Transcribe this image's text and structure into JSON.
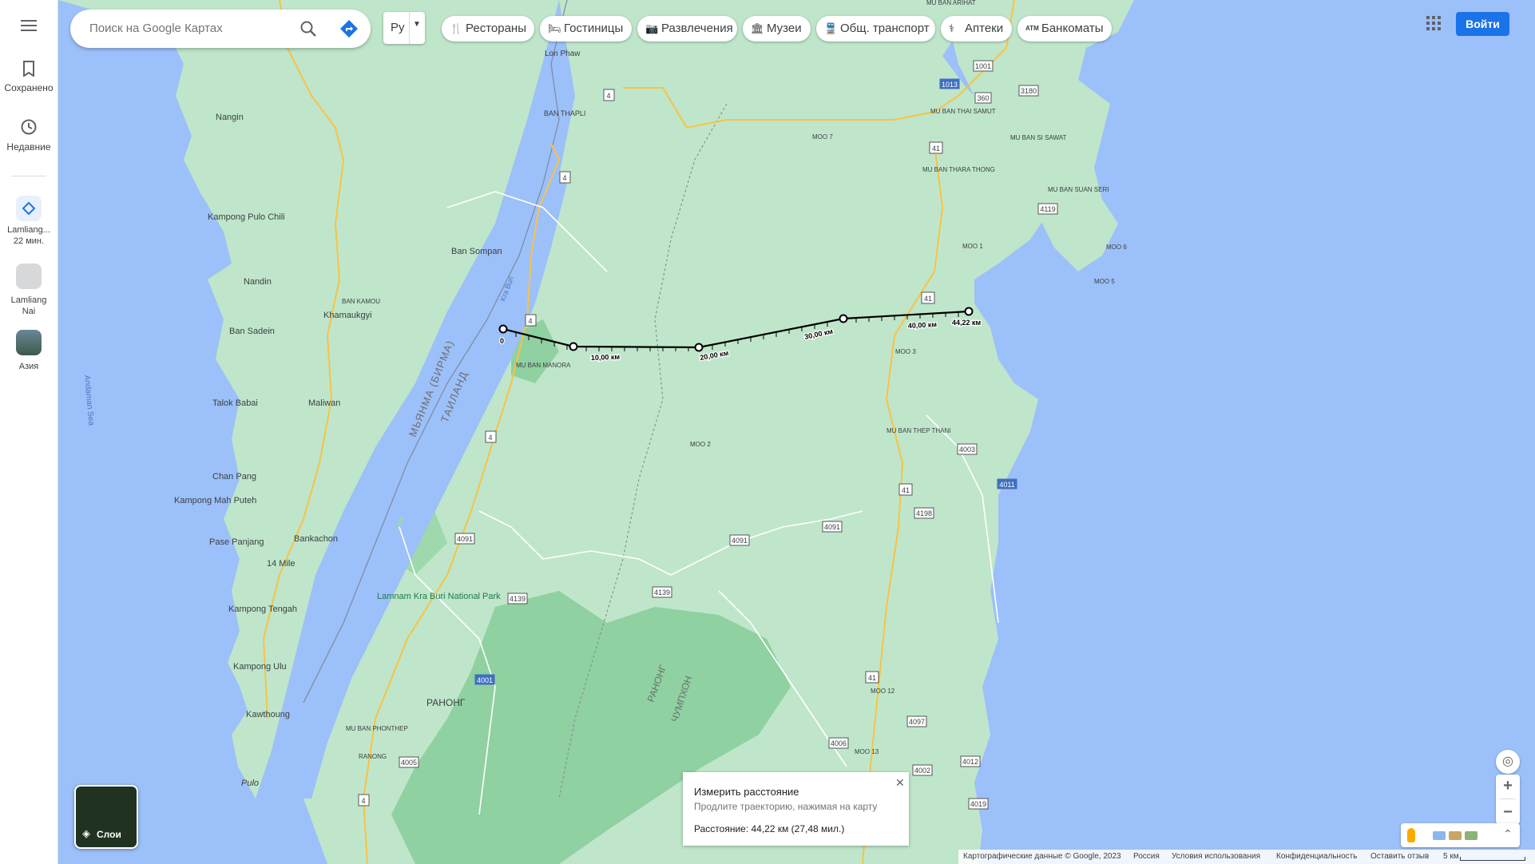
{
  "sidebar": {
    "menu_icon": "menu-icon",
    "items": [
      {
        "label": "Сохранено",
        "icon": "bookmark-icon"
      },
      {
        "label": "Недавние",
        "icon": "history-icon"
      },
      {
        "label": "Lamliang...",
        "sub": "22 мин.",
        "icon": "directions-icon"
      },
      {
        "label": "Lamliang Nai",
        "icon": "place-thumbnail"
      },
      {
        "label": "Азия",
        "icon": "place-thumbnail"
      }
    ]
  },
  "search": {
    "placeholder": "Поиск на Google Картах"
  },
  "language": {
    "code": "Ру"
  },
  "chips": [
    {
      "label": "Рестораны",
      "icon": "restaurant-icon"
    },
    {
      "label": "Гостиницы",
      "icon": "hotel-icon"
    },
    {
      "label": "Развлечения",
      "icon": "camera-icon"
    },
    {
      "label": "Музеи",
      "icon": "museum-icon"
    },
    {
      "label": "Общ. транспорт",
      "icon": "transit-icon"
    },
    {
      "label": "Аптеки",
      "icon": "pharmacy-icon"
    },
    {
      "label": "Банкоматы",
      "icon": "atm-icon"
    }
  ],
  "signin_label": "Войти",
  "layers_label": "Слои",
  "measure": {
    "title": "Измерить расстояние",
    "hint": "Продлите траекторию, нажимая на карту",
    "distance": "Расстояние: 44,22 км (27,48 мил.)"
  },
  "measure_path": {
    "tick_labels": [
      "0",
      "10,00 км",
      "20,00 км",
      "30,00 км",
      "40,00 км",
      "44,22 км"
    ]
  },
  "footer": {
    "copyright": "Картографические данные © Google, 2023",
    "country": "Россия",
    "terms": "Условия использования",
    "privacy": "Конфиденциальность",
    "feedback": "Оставить отзыв",
    "scale": "5 км"
  },
  "map_labels": {
    "places": [
      "Nangin",
      "Kampong Pulo Chili",
      "Nandin",
      "Ban Sadein",
      "Talok Babai",
      "Chan Pang",
      "Kampong Mah Puteh",
      "Pase Panjang",
      "14 Mile",
      "Kampong Tengah",
      "Kampong Ulu",
      "Kawthoung",
      "Pulo",
      "Khamaukgyi",
      "Maliwan",
      "Bankachon",
      "Ban Sompan",
      "Lon Phaw",
      "BAN THAPLI",
      "MU BAN MANORA",
      "Lamnam Kra Buri National Park",
      "РАНОНГ",
      "MU BAN PHONTHEP",
      "RANONG",
      "MOO 7",
      "MOO 2",
      "MU BAN THAI SAMUT",
      "MU BAN THARA THONG",
      "MU BAN SI SAWAT",
      "MU BAN SUAN SERI",
      "MOO 1",
      "MOO 6",
      "MOO 5",
      "MOO 3",
      "MU BAN THEP THANI",
      "MOO 12",
      "MOO 13",
      "MU BAN ARIHAT",
      "BAN KAMOU"
    ],
    "borders": [
      "МЬЯНМА (БИРМА)",
      "ТАИЛАНД",
      "РАНОНГ",
      "ЧУМПХОН"
    ],
    "sea": "Andaman Sea",
    "river": "Kra Buri",
    "roads": [
      "4",
      "41",
      "4091",
      "4139",
      "4001",
      "4005",
      "4006",
      "4002",
      "4012",
      "4019",
      "4097",
      "4003",
      "4011",
      "4198",
      "4119",
      "1001",
      "360",
      "3180",
      "1013"
    ]
  },
  "colors": {
    "water": "#9cc0f9",
    "land": "#bfe6ca",
    "forest": "#8fd1a0",
    "road": "#fdd26e",
    "accent": "#1a73e8"
  }
}
